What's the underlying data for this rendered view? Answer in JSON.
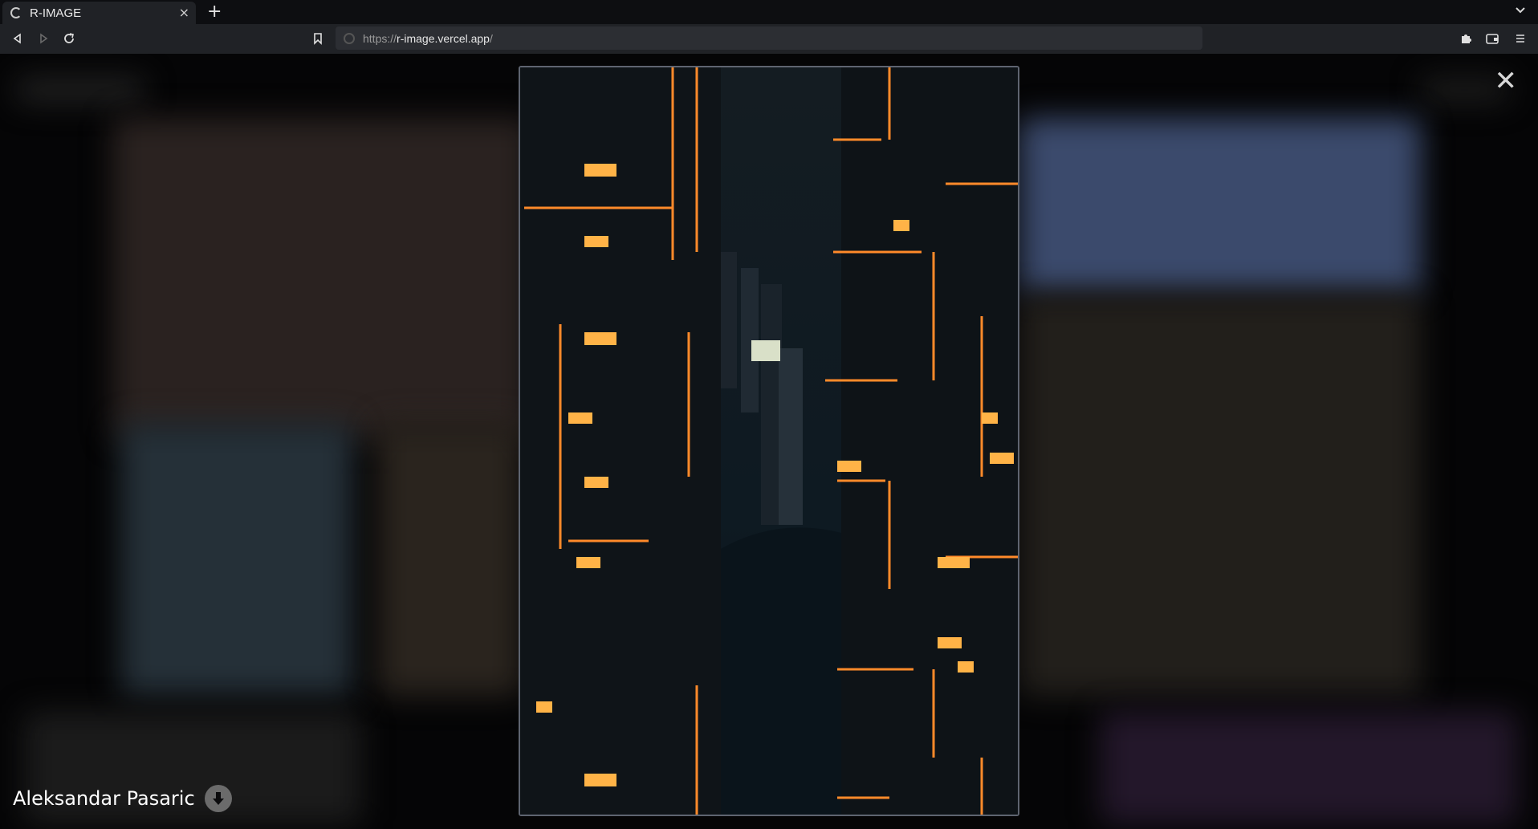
{
  "browser": {
    "tab_title": "R-IMAGE",
    "tab_close": "×",
    "new_tab": "+",
    "url_scheme": "https://",
    "url_host": "r-image.vercel.app",
    "url_path": "/"
  },
  "modal": {
    "close": "✕",
    "photographer": "Aleksandar Pasaric"
  },
  "colors": {
    "accent_orange": "#ff8a2a",
    "window_light": "#ffb347"
  }
}
